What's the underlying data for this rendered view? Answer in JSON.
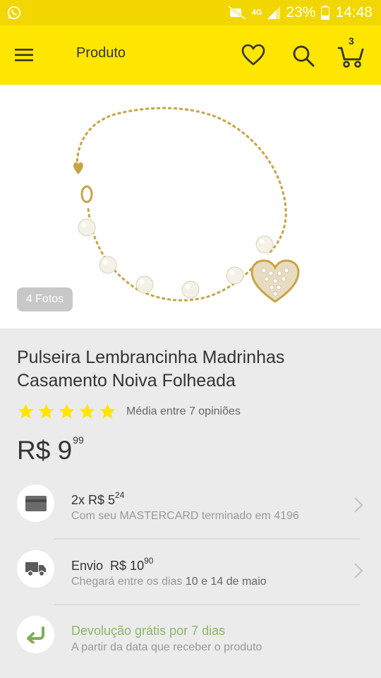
{
  "status_bar": {
    "battery": "23%",
    "time": "14:48",
    "network": "4G"
  },
  "toolbar": {
    "title": "Produto",
    "cart_count": "3"
  },
  "gallery": {
    "photos_label": "4 Fotos"
  },
  "product": {
    "title": "Pulseira Lembrancinha Madrinhas Casamento Noiva Folheada",
    "rating_stars": 5,
    "reviews_text": "Média entre 7 opiniões",
    "price_main": "R$ 9",
    "price_cents": "99"
  },
  "installments": {
    "prefix": "2x R$ 5",
    "cents": "24",
    "detail": "Com seu MASTERCARD terminado em 4196"
  },
  "shipping": {
    "label": "Envio",
    "price": "R$ 10",
    "cents": "90",
    "detail_prefix": "Chegará entre os dias",
    "detail_dates": "10 e 14 de maio"
  },
  "returns": {
    "title": "Devolução grátis por 7 dias",
    "detail": "A partir da data que receber o produto"
  },
  "colors": {
    "brand_yellow": "#fee600",
    "status_yellow": "#f2d600",
    "star": "#fee600",
    "return_green": "#8db869"
  }
}
